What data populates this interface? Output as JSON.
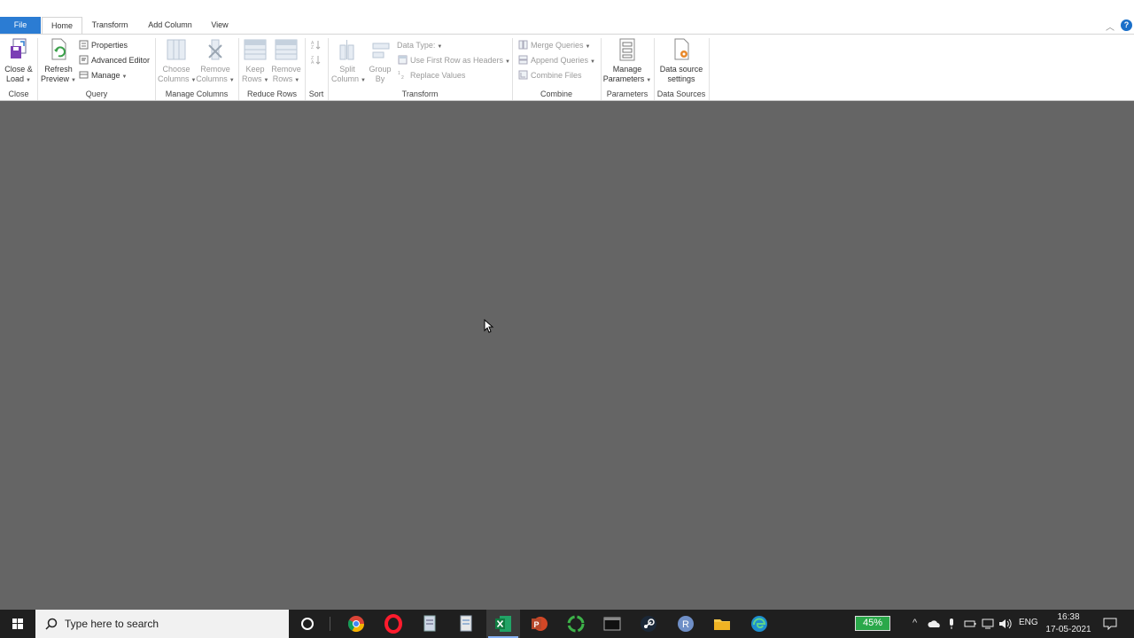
{
  "tabs": {
    "file": "File",
    "home": "Home",
    "transform": "Transform",
    "add_column": "Add Column",
    "view": "View"
  },
  "ribbon": {
    "close_group": {
      "label": "Close",
      "close_load": [
        "Close &",
        "Load"
      ]
    },
    "query_group": {
      "label": "Query",
      "refresh_preview": [
        "Refresh",
        "Preview"
      ],
      "properties": "Properties",
      "advanced_editor": "Advanced Editor",
      "manage": "Manage"
    },
    "manage_columns_group": {
      "label": "Manage Columns",
      "choose_columns": [
        "Choose",
        "Columns"
      ],
      "remove_columns": [
        "Remove",
        "Columns"
      ]
    },
    "reduce_rows_group": {
      "label": "Reduce Rows",
      "keep_rows": [
        "Keep",
        "Rows"
      ],
      "remove_rows": [
        "Remove",
        "Rows"
      ]
    },
    "sort_group": {
      "label": "Sort"
    },
    "transform_group": {
      "label": "Transform",
      "split_column": [
        "Split",
        "Column"
      ],
      "group_by": [
        "Group",
        "By"
      ],
      "data_type": "Data Type:",
      "first_row_headers": "Use First Row as Headers",
      "replace_values": "Replace Values"
    },
    "combine_group": {
      "label": "Combine",
      "merge_queries": "Merge Queries",
      "append_queries": "Append Queries",
      "combine_files": "Combine Files"
    },
    "parameters_group": {
      "label": "Parameters",
      "manage_parameters": [
        "Manage",
        "Parameters"
      ]
    },
    "data_sources_group": {
      "label": "Data Sources",
      "data_source_settings": [
        "Data source",
        "settings"
      ]
    }
  },
  "taskbar": {
    "search_placeholder": "Type here to search",
    "battery": "45%",
    "language": "ENG",
    "time": "16:38",
    "date": "17-05-2021"
  },
  "colors": {
    "accent": "#2b7cd3",
    "main_background": "#656565",
    "taskbar": "#1f1f1f"
  }
}
